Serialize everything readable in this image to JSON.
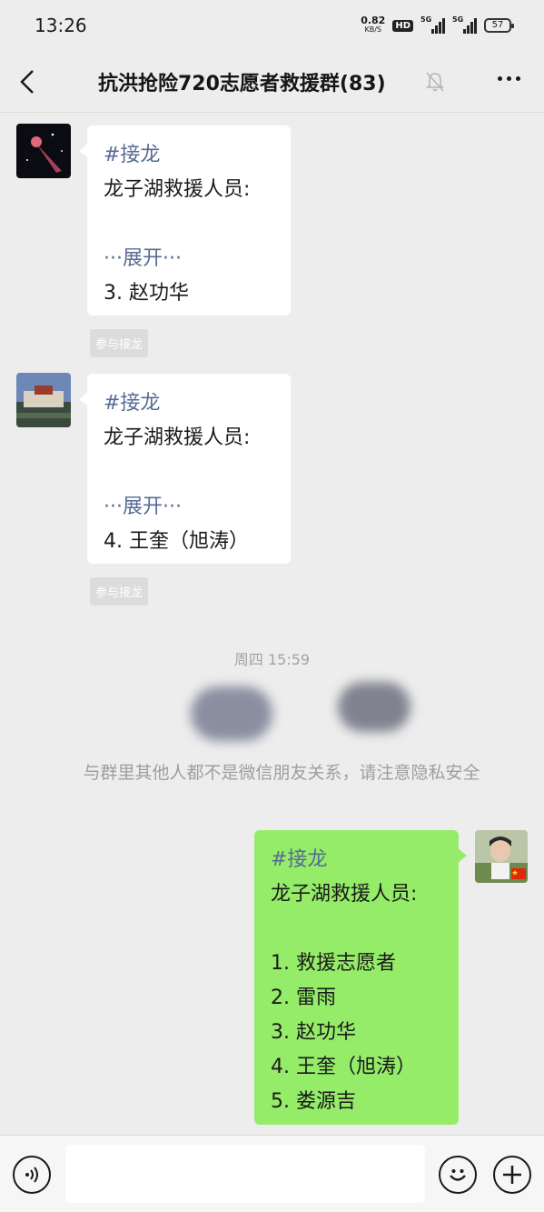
{
  "status_bar": {
    "time": "13:26",
    "net_speed": "0.82",
    "net_unit": "KB/S",
    "hd": "HD",
    "sim1": "5G",
    "sim2": "5G",
    "battery": "57"
  },
  "header": {
    "title": "抗洪抢险720志愿者救援群(83)"
  },
  "messages": [
    {
      "tag": "#接龙",
      "heading": "龙子湖救援人员:",
      "expand": "···展开···",
      "entry": "3. 赵功华",
      "join_label": "参与接龙"
    },
    {
      "tag": "#接龙",
      "heading": "龙子湖救援人员:",
      "expand": "···展开···",
      "entry": "4. 王奎（旭涛）",
      "join_label": "参与接龙"
    }
  ],
  "time_separator": "周四 15:59",
  "system_note": "与群里其他人都不是微信朋友关系，请注意隐私安全",
  "my_message": {
    "tag": "#接龙",
    "heading": "龙子湖救援人员:",
    "items": [
      "1. 救援志愿者",
      "2. 雷雨",
      "3. 赵功华",
      "4. 王奎（旭涛）",
      "5. 娄源吉"
    ]
  },
  "input": {
    "value": "",
    "placeholder": ""
  },
  "colors": {
    "background": "#ededed",
    "my_bubble": "#95ec69",
    "other_bubble": "#ffffff",
    "tag": "#576b95"
  }
}
